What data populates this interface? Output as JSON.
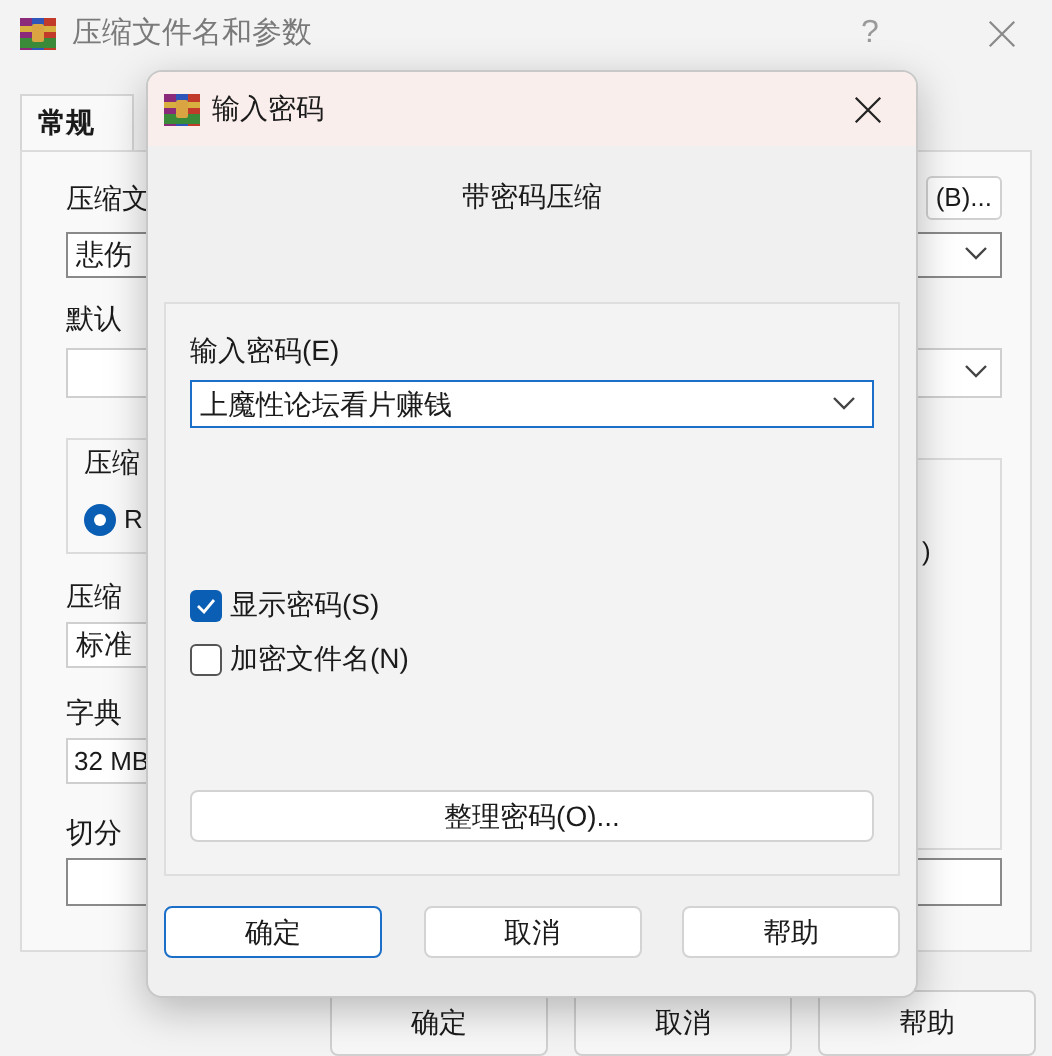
{
  "main_window": {
    "title": "压缩文件名和参数",
    "help_button": "?",
    "tabs": [
      {
        "label": "常规",
        "selected": true
      }
    ],
    "form": {
      "archive_name_label": "压缩文",
      "browse_button": "(B)...",
      "archive_name_value": "悲伤",
      "profile_label": "默认",
      "format_group_label": "压缩",
      "format_radio": {
        "label": "R",
        "selected": true
      },
      "options_group_fragment": ")",
      "method_label": "压缩",
      "method_value": "标准",
      "dictionary_label": "字典",
      "dictionary_value": "32 MB",
      "split_label": "切分"
    },
    "buttons": [
      "确定",
      "取消",
      "帮助"
    ]
  },
  "dialog": {
    "title": "输入密码",
    "heading": "带密码压缩",
    "password_label": "输入密码(E)",
    "password_value": "上魔性论坛看片赚钱",
    "options": [
      {
        "label": "显示密码(S)",
        "checked": true
      },
      {
        "label": "加密文件名(N)",
        "checked": false
      }
    ],
    "organize_button": "整理密码(O)...",
    "buttons": [
      {
        "label": "确定",
        "default": true
      },
      {
        "label": "取消",
        "default": false
      },
      {
        "label": "帮助",
        "default": false
      }
    ]
  }
}
